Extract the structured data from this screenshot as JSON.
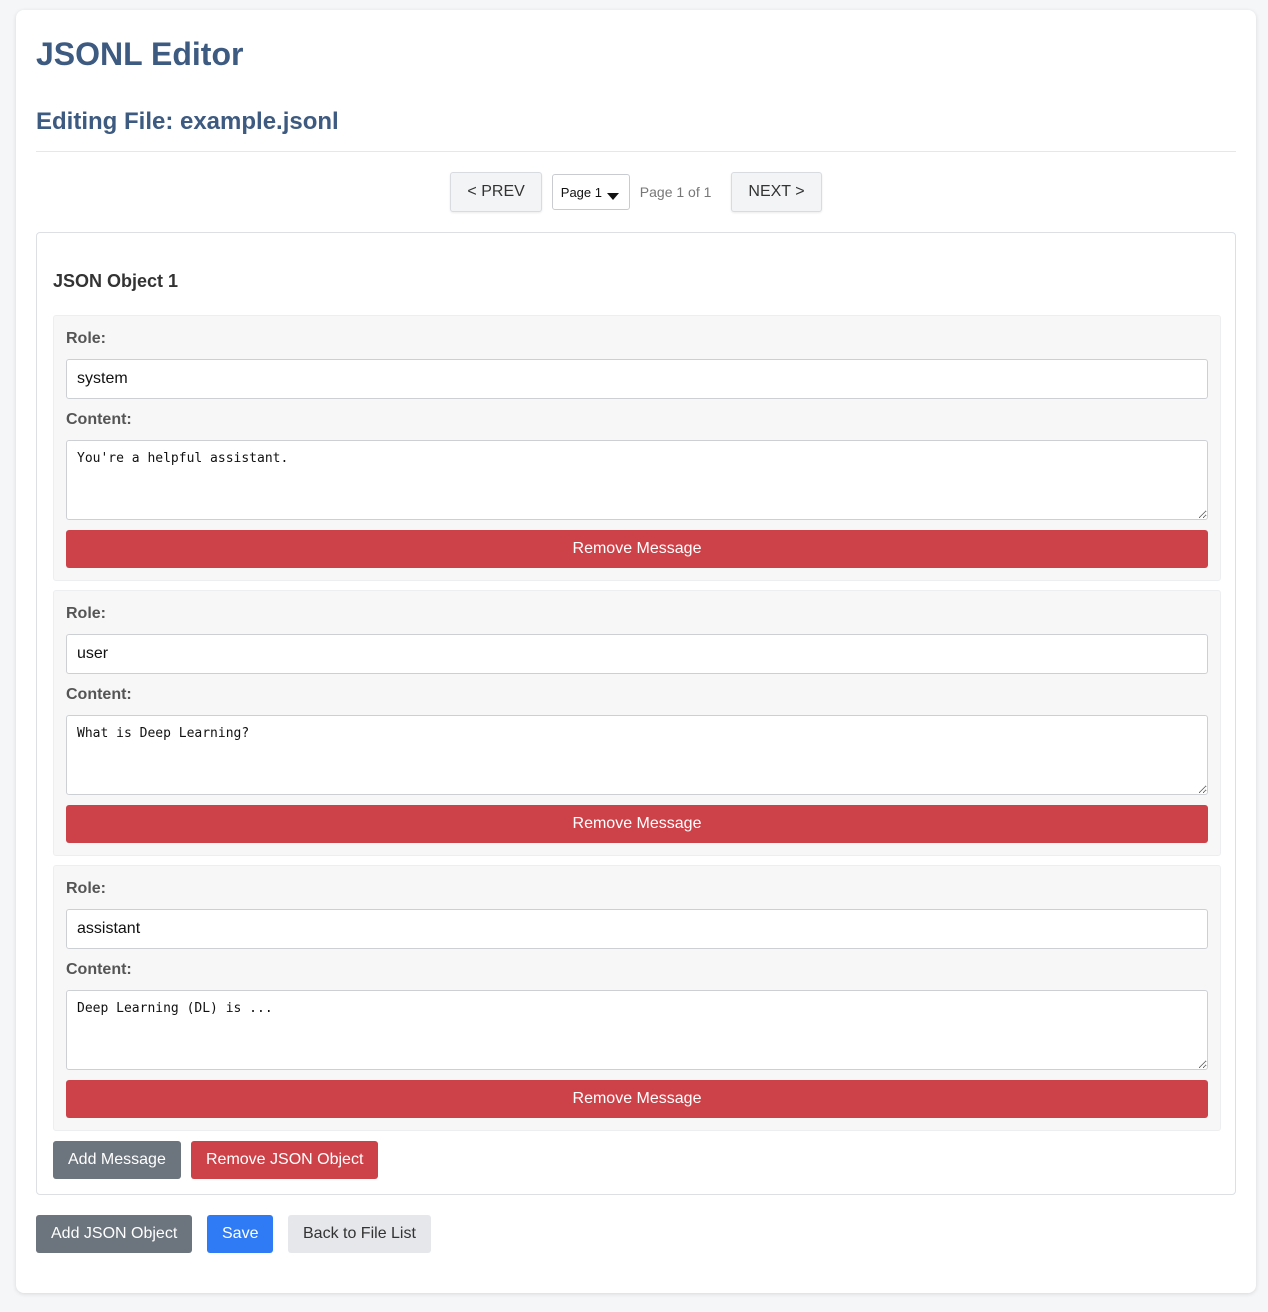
{
  "app": {
    "title": "JSONL Editor",
    "editing_label": "Editing File: example.jsonl"
  },
  "pagination": {
    "prev_label": "< PREV",
    "selected_page": "Page 1",
    "info": "Page 1 of 1",
    "next_label": "NEXT >"
  },
  "objects": [
    {
      "title": "JSON Object 1",
      "messages": [
        {
          "role_label": "Role:",
          "role": "system",
          "content_label": "Content:",
          "content": "You're a helpful assistant.",
          "remove_label": "Remove Message"
        },
        {
          "role_label": "Role:",
          "role": "user",
          "content_label": "Content:",
          "content": "What is Deep Learning?",
          "remove_label": "Remove Message"
        },
        {
          "role_label": "Role:",
          "role": "assistant",
          "content_label": "Content:",
          "content": "Deep Learning (DL) is ...",
          "remove_label": "Remove Message"
        }
      ],
      "add_message_label": "Add Message",
      "remove_object_label": "Remove JSON Object"
    }
  ],
  "footer": {
    "add_object_label": "Add JSON Object",
    "save_label": "Save",
    "back_label": "Back to File List"
  },
  "colors": {
    "heading": "#3d5a80",
    "danger": "#cd4249",
    "primary": "#2f7bf5",
    "secondary": "#6c747d"
  }
}
